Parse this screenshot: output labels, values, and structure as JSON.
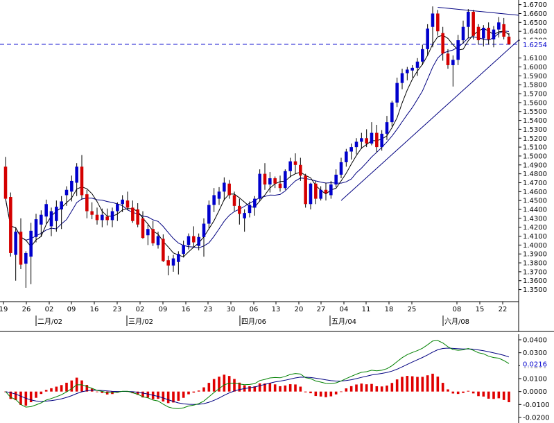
{
  "chart_data": [
    {
      "type": "candlestick",
      "price_axis": {
        "ylim": [
          1.345,
          1.6705
        ],
        "ticks": [
          "1.3500",
          "1.3600",
          "1.3700",
          "1.3800",
          "1.3900",
          "1.4000",
          "1.4100",
          "1.4200",
          "1.4300",
          "1.4400",
          "1.4500",
          "1.4600",
          "1.4700",
          "1.4800",
          "1.4900",
          "1.5000",
          "1.5100",
          "1.5200",
          "1.5300",
          "1.5400",
          "1.5500",
          "1.5600",
          "1.5700",
          "1.5800",
          "1.5900",
          "1.6000",
          "1.6100",
          "1.6300",
          "1.6400",
          "1.6500",
          "1.6600",
          "1.6700"
        ],
        "current_price": 1.6254,
        "current_price_label": "1.6254"
      },
      "x_day_labels": [
        "19",
        "26",
        "02",
        "09",
        "16",
        "23",
        "02",
        "09",
        "16",
        "23",
        "30",
        "06",
        "13",
        "20",
        "27",
        "04",
        "11",
        "18",
        "25",
        "08",
        "15",
        "22"
      ],
      "x_month_labels": [
        "二月/02",
        "三月/02",
        "四月/06",
        "五月/04",
        "六月/08"
      ],
      "candles": [
        {
          "o": 1.488,
          "h": 1.499,
          "l": 1.458,
          "c": 1.452
        },
        {
          "o": 1.454,
          "h": 1.459,
          "l": 1.387,
          "c": 1.391
        },
        {
          "o": 1.389,
          "h": 1.42,
          "l": 1.36,
          "c": 1.415
        },
        {
          "o": 1.415,
          "h": 1.43,
          "l": 1.373,
          "c": 1.378
        },
        {
          "o": 1.379,
          "h": 1.393,
          "l": 1.352,
          "c": 1.391
        },
        {
          "o": 1.387,
          "h": 1.425,
          "l": 1.356,
          "c": 1.416
        },
        {
          "o": 1.409,
          "h": 1.435,
          "l": 1.403,
          "c": 1.429
        },
        {
          "o": 1.423,
          "h": 1.439,
          "l": 1.409,
          "c": 1.434
        },
        {
          "o": 1.432,
          "h": 1.451,
          "l": 1.424,
          "c": 1.446
        },
        {
          "o": 1.421,
          "h": 1.442,
          "l": 1.41,
          "c": 1.438
        },
        {
          "o": 1.427,
          "h": 1.45,
          "l": 1.415,
          "c": 1.443
        },
        {
          "o": 1.44,
          "h": 1.455,
          "l": 1.418,
          "c": 1.449
        },
        {
          "o": 1.456,
          "h": 1.466,
          "l": 1.444,
          "c": 1.462
        },
        {
          "o": 1.46,
          "h": 1.478,
          "l": 1.449,
          "c": 1.472
        },
        {
          "o": 1.47,
          "h": 1.492,
          "l": 1.455,
          "c": 1.488
        },
        {
          "o": 1.488,
          "h": 1.501,
          "l": 1.451,
          "c": 1.456
        },
        {
          "o": 1.457,
          "h": 1.462,
          "l": 1.43,
          "c": 1.438
        },
        {
          "o": 1.438,
          "h": 1.448,
          "l": 1.429,
          "c": 1.434
        },
        {
          "o": 1.434,
          "h": 1.442,
          "l": 1.423,
          "c": 1.428
        },
        {
          "o": 1.428,
          "h": 1.441,
          "l": 1.42,
          "c": 1.434
        },
        {
          "o": 1.432,
          "h": 1.441,
          "l": 1.422,
          "c": 1.428
        },
        {
          "o": 1.428,
          "h": 1.442,
          "l": 1.42,
          "c": 1.438
        },
        {
          "o": 1.438,
          "h": 1.448,
          "l": 1.427,
          "c": 1.446
        },
        {
          "o": 1.446,
          "h": 1.456,
          "l": 1.437,
          "c": 1.451
        },
        {
          "o": 1.45,
          "h": 1.46,
          "l": 1.439,
          "c": 1.442
        },
        {
          "o": 1.442,
          "h": 1.45,
          "l": 1.425,
          "c": 1.427
        },
        {
          "o": 1.44,
          "h": 1.447,
          "l": 1.42,
          "c": 1.423
        },
        {
          "o": 1.43,
          "h": 1.438,
          "l": 1.407,
          "c": 1.408
        },
        {
          "o": 1.411,
          "h": 1.423,
          "l": 1.4,
          "c": 1.418
        },
        {
          "o": 1.418,
          "h": 1.427,
          "l": 1.399,
          "c": 1.402
        },
        {
          "o": 1.4,
          "h": 1.415,
          "l": 1.396,
          "c": 1.41
        },
        {
          "o": 1.407,
          "h": 1.412,
          "l": 1.381,
          "c": 1.382
        },
        {
          "o": 1.383,
          "h": 1.388,
          "l": 1.366,
          "c": 1.377
        },
        {
          "o": 1.377,
          "h": 1.389,
          "l": 1.37,
          "c": 1.385
        },
        {
          "o": 1.381,
          "h": 1.393,
          "l": 1.367,
          "c": 1.39
        },
        {
          "o": 1.39,
          "h": 1.405,
          "l": 1.386,
          "c": 1.4
        },
        {
          "o": 1.4,
          "h": 1.413,
          "l": 1.395,
          "c": 1.41
        },
        {
          "o": 1.41,
          "h": 1.421,
          "l": 1.397,
          "c": 1.403
        },
        {
          "o": 1.399,
          "h": 1.413,
          "l": 1.394,
          "c": 1.409
        },
        {
          "o": 1.409,
          "h": 1.43,
          "l": 1.387,
          "c": 1.424
        },
        {
          "o": 1.424,
          "h": 1.45,
          "l": 1.418,
          "c": 1.445
        },
        {
          "o": 1.445,
          "h": 1.464,
          "l": 1.437,
          "c": 1.456
        },
        {
          "o": 1.452,
          "h": 1.465,
          "l": 1.445,
          "c": 1.46
        },
        {
          "o": 1.46,
          "h": 1.476,
          "l": 1.45,
          "c": 1.47
        },
        {
          "o": 1.469,
          "h": 1.473,
          "l": 1.452,
          "c": 1.456
        },
        {
          "o": 1.456,
          "h": 1.46,
          "l": 1.438,
          "c": 1.444
        },
        {
          "o": 1.444,
          "h": 1.452,
          "l": 1.423,
          "c": 1.435
        },
        {
          "o": 1.43,
          "h": 1.44,
          "l": 1.415,
          "c": 1.436
        },
        {
          "o": 1.436,
          "h": 1.449,
          "l": 1.431,
          "c": 1.445
        },
        {
          "o": 1.442,
          "h": 1.455,
          "l": 1.433,
          "c": 1.452
        },
        {
          "o": 1.452,
          "h": 1.485,
          "l": 1.449,
          "c": 1.48
        },
        {
          "o": 1.48,
          "h": 1.492,
          "l": 1.462,
          "c": 1.468
        },
        {
          "o": 1.468,
          "h": 1.482,
          "l": 1.459,
          "c": 1.475
        },
        {
          "o": 1.475,
          "h": 1.477,
          "l": 1.464,
          "c": 1.469
        },
        {
          "o": 1.469,
          "h": 1.478,
          "l": 1.46,
          "c": 1.464
        },
        {
          "o": 1.464,
          "h": 1.485,
          "l": 1.462,
          "c": 1.483
        },
        {
          "o": 1.483,
          "h": 1.498,
          "l": 1.476,
          "c": 1.494
        },
        {
          "o": 1.494,
          "h": 1.503,
          "l": 1.48,
          "c": 1.49
        },
        {
          "o": 1.49,
          "h": 1.498,
          "l": 1.472,
          "c": 1.478
        },
        {
          "o": 1.478,
          "h": 1.48,
          "l": 1.442,
          "c": 1.446
        },
        {
          "o": 1.446,
          "h": 1.47,
          "l": 1.44,
          "c": 1.469
        },
        {
          "o": 1.469,
          "h": 1.472,
          "l": 1.446,
          "c": 1.452
        },
        {
          "o": 1.452,
          "h": 1.466,
          "l": 1.45,
          "c": 1.462
        },
        {
          "o": 1.462,
          "h": 1.47,
          "l": 1.45,
          "c": 1.458
        },
        {
          "o": 1.456,
          "h": 1.472,
          "l": 1.452,
          "c": 1.468
        },
        {
          "o": 1.468,
          "h": 1.485,
          "l": 1.465,
          "c": 1.479
        },
        {
          "o": 1.479,
          "h": 1.498,
          "l": 1.475,
          "c": 1.493
        },
        {
          "o": 1.493,
          "h": 1.508,
          "l": 1.488,
          "c": 1.505
        },
        {
          "o": 1.505,
          "h": 1.514,
          "l": 1.496,
          "c": 1.51
        },
        {
          "o": 1.51,
          "h": 1.52,
          "l": 1.502,
          "c": 1.516
        },
        {
          "o": 1.516,
          "h": 1.526,
          "l": 1.508,
          "c": 1.52
        },
        {
          "o": 1.52,
          "h": 1.53,
          "l": 1.51,
          "c": 1.514
        },
        {
          "o": 1.514,
          "h": 1.538,
          "l": 1.512,
          "c": 1.526
        },
        {
          "o": 1.526,
          "h": 1.535,
          "l": 1.504,
          "c": 1.51
        },
        {
          "o": 1.51,
          "h": 1.529,
          "l": 1.506,
          "c": 1.525
        },
        {
          "o": 1.525,
          "h": 1.545,
          "l": 1.518,
          "c": 1.538
        },
        {
          "o": 1.538,
          "h": 1.562,
          "l": 1.533,
          "c": 1.56
        },
        {
          "o": 1.56,
          "h": 1.588,
          "l": 1.555,
          "c": 1.582
        },
        {
          "o": 1.582,
          "h": 1.598,
          "l": 1.575,
          "c": 1.593
        },
        {
          "o": 1.593,
          "h": 1.6,
          "l": 1.585,
          "c": 1.597
        },
        {
          "o": 1.596,
          "h": 1.602,
          "l": 1.588,
          "c": 1.599
        },
        {
          "o": 1.599,
          "h": 1.61,
          "l": 1.59,
          "c": 1.606
        },
        {
          "o": 1.606,
          "h": 1.625,
          "l": 1.602,
          "c": 1.62
        },
        {
          "o": 1.62,
          "h": 1.648,
          "l": 1.613,
          "c": 1.643
        },
        {
          "o": 1.645,
          "h": 1.668,
          "l": 1.622,
          "c": 1.66
        },
        {
          "o": 1.66,
          "h": 1.664,
          "l": 1.635,
          "c": 1.64
        },
        {
          "o": 1.638,
          "h": 1.645,
          "l": 1.607,
          "c": 1.615
        },
        {
          "o": 1.615,
          "h": 1.62,
          "l": 1.598,
          "c": 1.602
        },
        {
          "o": 1.602,
          "h": 1.613,
          "l": 1.578,
          "c": 1.608
        },
        {
          "o": 1.608,
          "h": 1.636,
          "l": 1.602,
          "c": 1.63
        },
        {
          "o": 1.63,
          "h": 1.652,
          "l": 1.626,
          "c": 1.645
        },
        {
          "o": 1.645,
          "h": 1.665,
          "l": 1.632,
          "c": 1.662
        },
        {
          "o": 1.662,
          "h": 1.664,
          "l": 1.631,
          "c": 1.635
        },
        {
          "o": 1.645,
          "h": 1.648,
          "l": 1.625,
          "c": 1.63
        },
        {
          "o": 1.632,
          "h": 1.647,
          "l": 1.623,
          "c": 1.644
        },
        {
          "o": 1.644,
          "h": 1.65,
          "l": 1.625,
          "c": 1.631
        },
        {
          "o": 1.631,
          "h": 1.646,
          "l": 1.622,
          "c": 1.642
        },
        {
          "o": 1.642,
          "h": 1.656,
          "l": 1.633,
          "c": 1.65
        },
        {
          "o": 1.648,
          "h": 1.655,
          "l": 1.631,
          "c": 1.634
        },
        {
          "o": 1.634,
          "h": 1.638,
          "l": 1.625,
          "c": 1.6254
        }
      ],
      "trendlines": [
        {
          "p1": {
            "i": 85,
            "v": 1.667
          },
          "p2": {
            "i": 101,
            "v": 1.658
          },
          "extend": true
        },
        {
          "p1": {
            "i": 66,
            "v": 1.45
          },
          "p2": {
            "i": 100,
            "v": 1.6254
          },
          "extend": true
        }
      ],
      "colors": {
        "up": "#0000cc",
        "down": "#d40000",
        "ma_fast": "#000000",
        "ma_slow": "#000080",
        "current_line": "#0000cc"
      }
    },
    {
      "type": "macd",
      "ylim": [
        -0.0215,
        0.0435
      ],
      "ticks": [
        "0.0400",
        "0.0300",
        "0.0200",
        "0.0100",
        "0.0000",
        "-0.0100",
        "-0.0200"
      ],
      "current_value": 0.0216,
      "current_value_label": "0.0216",
      "colors": {
        "macd": "#008000",
        "signal": "#000080",
        "hist": "#e00000"
      }
    }
  ]
}
